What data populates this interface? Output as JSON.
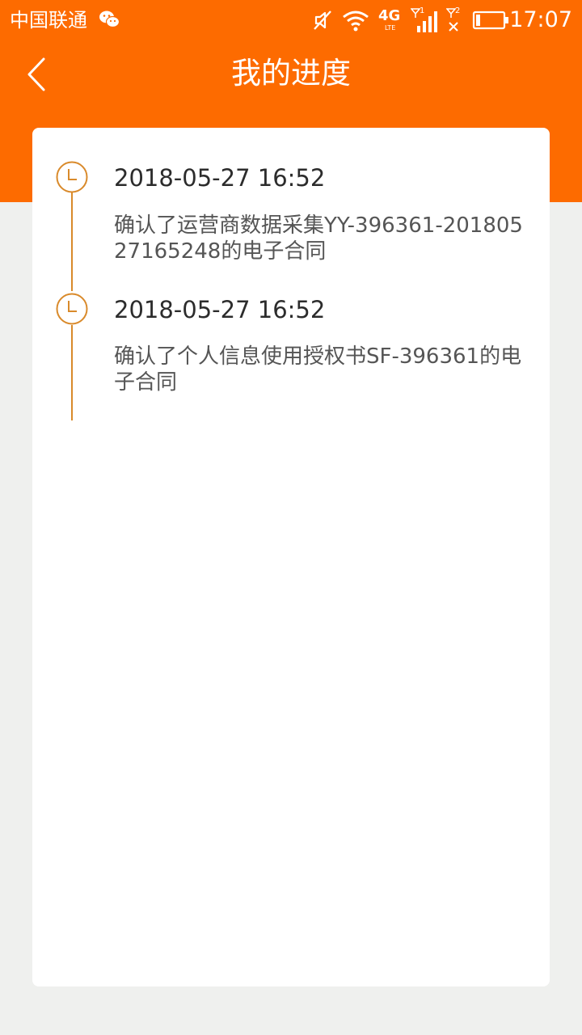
{
  "status_bar": {
    "carrier": "中国联通",
    "network": "4G",
    "sim1": "1",
    "sim2": "2",
    "time": "17:07"
  },
  "header": {
    "title": "我的进度"
  },
  "timeline": [
    {
      "time": "2018-05-27 16:52",
      "text": "确认了运营商数据采集YY-396361-20180527165248的电子合同"
    },
    {
      "time": "2018-05-27 16:52",
      "text": "确认了个人信息使用授权书SF-396361的电子合同"
    }
  ],
  "colors": {
    "accent": "#fd6b00",
    "timeline": "#d98a2b",
    "background": "#eff0ee",
    "card": "#ffffff"
  }
}
